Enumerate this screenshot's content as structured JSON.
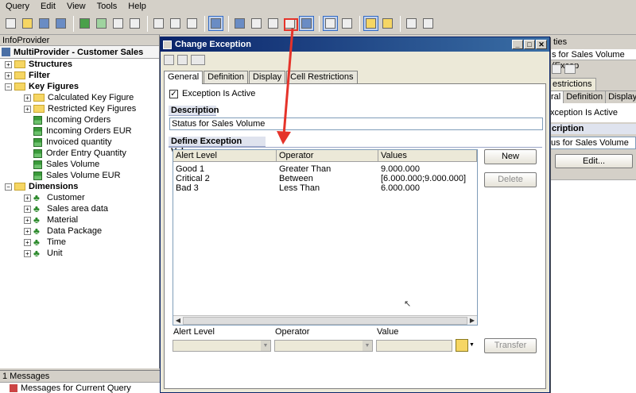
{
  "menu": [
    "Query",
    "Edit",
    "View",
    "Tools",
    "Help"
  ],
  "left_panel": {
    "header": "InfoProvider",
    "provider": "MultiProvider - Customer Sales",
    "tree": [
      {
        "label": "Structures",
        "kind": "folder",
        "bold": true,
        "level": 0
      },
      {
        "label": "Filter",
        "kind": "folder",
        "bold": true,
        "level": 0
      },
      {
        "label": "Key Figures",
        "kind": "folder",
        "bold": true,
        "level": 0
      },
      {
        "label": "Calculated Key Figure",
        "kind": "folder",
        "bold": false,
        "level": 1
      },
      {
        "label": "Restricted Key Figures",
        "kind": "folder",
        "bold": false,
        "level": 1
      },
      {
        "label": "Incoming Orders",
        "kind": "keyfigure",
        "bold": false,
        "level": 1
      },
      {
        "label": "Incoming Orders EUR",
        "kind": "keyfigure",
        "bold": false,
        "level": 1
      },
      {
        "label": "Invoiced quantity",
        "kind": "keyfigure",
        "bold": false,
        "level": 1
      },
      {
        "label": "Order Entry Quantity",
        "kind": "keyfigure",
        "bold": false,
        "level": 1
      },
      {
        "label": "Sales Volume",
        "kind": "keyfigure",
        "bold": false,
        "level": 1
      },
      {
        "label": "Sales Volume EUR",
        "kind": "keyfigure",
        "bold": false,
        "level": 1
      },
      {
        "label": "Dimensions",
        "kind": "folder",
        "bold": true,
        "level": 0
      },
      {
        "label": "Customer",
        "kind": "dimension",
        "bold": false,
        "level": 1
      },
      {
        "label": "Sales area data",
        "kind": "dimension",
        "bold": false,
        "level": 1
      },
      {
        "label": "Material",
        "kind": "dimension",
        "bold": false,
        "level": 1
      },
      {
        "label": "Data Package",
        "kind": "dimension",
        "bold": false,
        "level": 1
      },
      {
        "label": "Time",
        "kind": "dimension",
        "bold": false,
        "level": 1
      },
      {
        "label": "Unit",
        "kind": "dimension",
        "bold": false,
        "level": 1
      }
    ]
  },
  "messages": {
    "header": "1 Messages",
    "item": "Messages for Current Query"
  },
  "right_panel": {
    "title_fragment": "ties",
    "subtitle": "s for Sales Volume (Excep",
    "tab_restrictions": "estrictions",
    "tabs": [
      "ral",
      "Definition",
      "Display"
    ],
    "exception_active": "xception Is Active",
    "description_label": "cription",
    "description_value": "us for Sales Volume",
    "edit_button": "Edit..."
  },
  "dialog": {
    "title": "Change Exception",
    "tabs": [
      "General",
      "Definition",
      "Display",
      "Cell Restrictions"
    ],
    "active_tab": "General",
    "exception_active_label": "Exception Is Active",
    "exception_active_checked": true,
    "description_label": "Description",
    "description_value": "Status for Sales Volume",
    "define_label": "Define Exception Values",
    "grid": {
      "columns": [
        "Alert Level",
        "Operator",
        "Values"
      ],
      "rows": [
        [
          "Good 1",
          "Greater Than",
          "9.000.000"
        ],
        [
          "Critical 2",
          "Between",
          "[6.000.000;9.000.000]"
        ],
        [
          "Bad 3",
          "Less Than",
          "6.000.000"
        ]
      ]
    },
    "buttons": {
      "new": "New",
      "delete": "Delete",
      "transfer": "Transfer"
    },
    "fields": {
      "alert_level": "Alert Level",
      "operator": "Operator",
      "value": "Value"
    }
  },
  "colors": {
    "title_bar": "#0a246a",
    "annotation_arrow": "#e5332a"
  }
}
